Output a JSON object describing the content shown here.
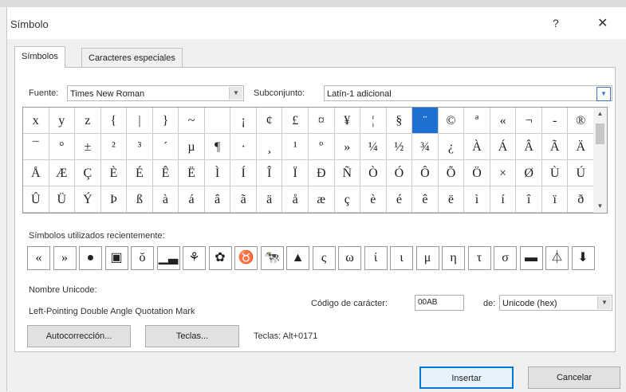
{
  "window": {
    "title": "Símbolo",
    "help": "?",
    "close": "✕"
  },
  "tabs": [
    {
      "label": "Símbolos"
    },
    {
      "label": "Caracteres especiales"
    }
  ],
  "font": {
    "label": "Fuente:",
    "value": "Times New Roman"
  },
  "subset": {
    "label": "Subconjunto:",
    "value": "Latín-1 adicional"
  },
  "grid": {
    "selected_row": 0,
    "selected_col": 15,
    "rows": [
      [
        "x",
        "y",
        "z",
        "{",
        "|",
        "}",
        "~",
        "",
        "¡",
        "¢",
        "£",
        "¤",
        "¥",
        "¦",
        "§",
        "¨",
        "©",
        "ª",
        "«",
        "¬",
        "-",
        "®"
      ],
      [
        "¯",
        "°",
        "±",
        "²",
        "³",
        "´",
        "µ",
        "¶",
        "·",
        "¸",
        "¹",
        "º",
        "»",
        "¼",
        "½",
        "¾",
        "¿",
        "À",
        "Á",
        "Â",
        "Ã",
        "Ä"
      ],
      [
        "Å",
        "Æ",
        "Ç",
        "È",
        "É",
        "Ê",
        "Ë",
        "Ì",
        "Í",
        "Î",
        "Ï",
        "Ð",
        "Ñ",
        "Ò",
        "Ó",
        "Ô",
        "Õ",
        "Ö",
        "×",
        "Ø",
        "Ù",
        "Ú"
      ],
      [
        "Û",
        "Ü",
        "Ý",
        "Þ",
        "ß",
        "à",
        "á",
        "â",
        "ã",
        "ä",
        "å",
        "æ",
        "ç",
        "è",
        "é",
        "ê",
        "ë",
        "ì",
        "í",
        "î",
        "ï",
        "ð"
      ]
    ]
  },
  "recent": {
    "label": "Símbolos utilizados recientemente:",
    "items": [
      "«",
      "»",
      "●",
      "▣",
      "ŏ",
      "▁▃",
      "⚘",
      "✿",
      "♉",
      "🐄",
      "▲",
      "ς",
      "ω",
      "ί",
      "ι",
      "μ",
      "η",
      "τ",
      "σ",
      "▬",
      "⏃",
      "⬇"
    ]
  },
  "unicode": {
    "label": "Nombre Unicode:",
    "name": "Left-Pointing Double Angle Quotation Mark"
  },
  "code": {
    "label": "Código de carácter:",
    "value": "00AB",
    "from_label": "de:",
    "from_value": "Unicode (hex)"
  },
  "buttons": {
    "autocorrect": "Autocorrección...",
    "keys": "Teclas...",
    "shortcut": "Teclas: Alt+0171",
    "insert": "Insertar",
    "cancel": "Cancelar"
  }
}
